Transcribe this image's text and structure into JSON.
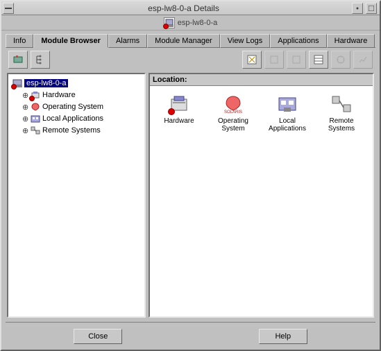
{
  "window": {
    "title": "esp-lw8-0-a Details"
  },
  "header": {
    "hostname": "esp-lw8-0-a"
  },
  "tabs": [
    {
      "label": "Info",
      "active": false
    },
    {
      "label": "Module Browser",
      "active": true
    },
    {
      "label": "Alarms",
      "active": false
    },
    {
      "label": "Module Manager",
      "active": false
    },
    {
      "label": "View Logs",
      "active": false
    },
    {
      "label": "Applications",
      "active": false
    },
    {
      "label": "Hardware",
      "active": false
    }
  ],
  "tree": {
    "root": {
      "label": "esp-lw8-0-a",
      "selected": true
    },
    "children": [
      {
        "label": "Hardware",
        "alert": true
      },
      {
        "label": "Operating System",
        "alert": false
      },
      {
        "label": "Local Applications",
        "alert": false
      },
      {
        "label": "Remote Systems",
        "alert": false
      }
    ]
  },
  "detail": {
    "header": "Location:",
    "items": [
      {
        "label": "Hardware",
        "alert": true
      },
      {
        "label": "Operating System",
        "alert": false
      },
      {
        "label": "Local Applications",
        "alert": false
      },
      {
        "label": "Remote Systems",
        "alert": false
      }
    ]
  },
  "buttons": {
    "close": "Close",
    "help": "Help"
  }
}
